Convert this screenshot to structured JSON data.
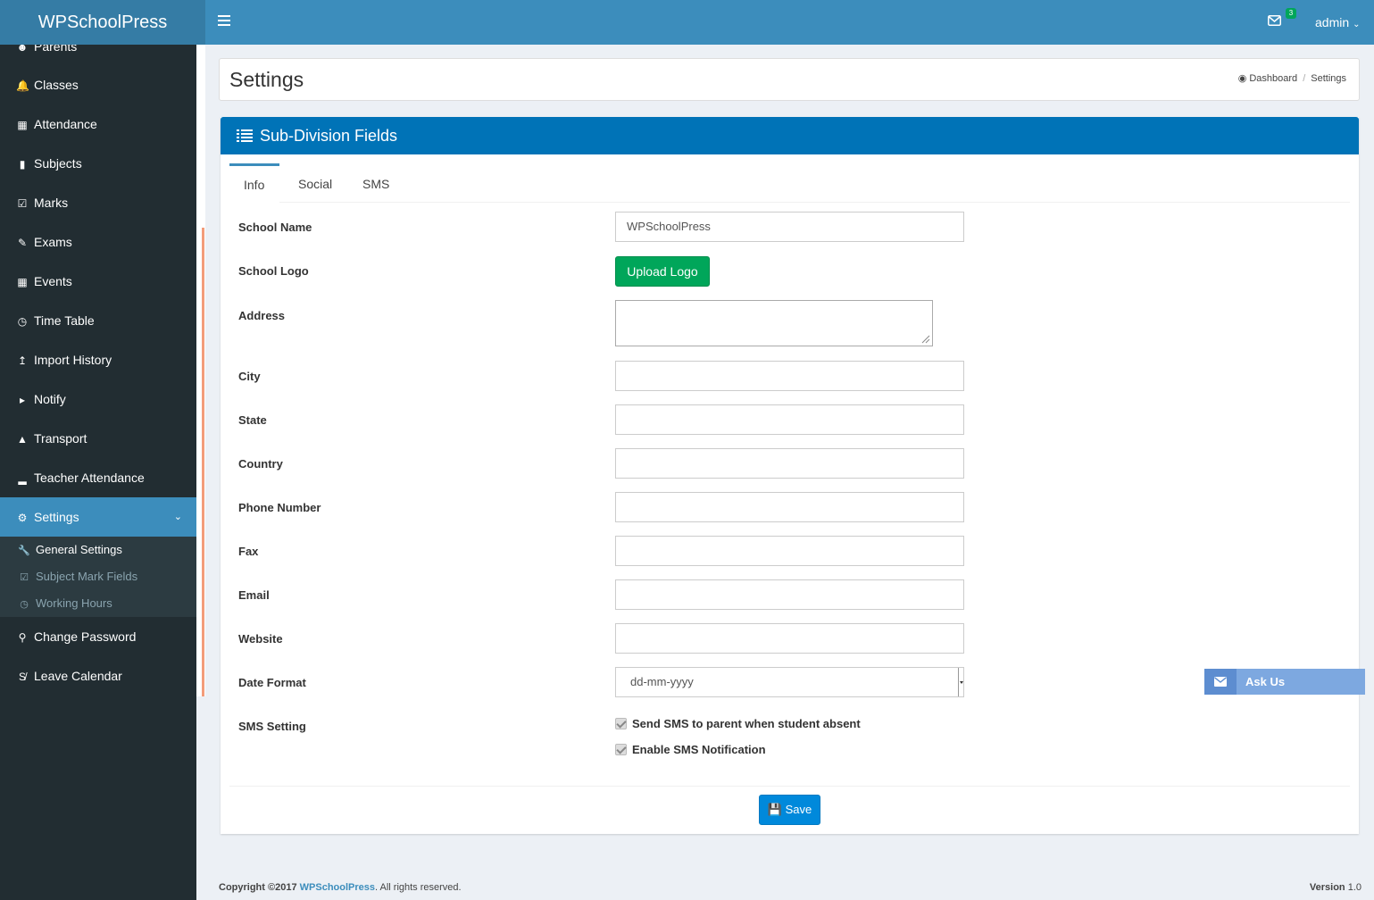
{
  "app": {
    "logo": "WPSchoolPress"
  },
  "topbar": {
    "mail_count": "3",
    "user": "admin"
  },
  "sidebar": {
    "items": [
      {
        "label": "Parents",
        "icon": "users-icon"
      },
      {
        "label": "Classes",
        "icon": "bell-icon"
      },
      {
        "label": "Attendance",
        "icon": "table-icon"
      },
      {
        "label": "Subjects",
        "icon": "book-icon"
      },
      {
        "label": "Marks",
        "icon": "check-square-icon"
      },
      {
        "label": "Exams",
        "icon": "edit-icon"
      },
      {
        "label": "Events",
        "icon": "calendar-icon"
      },
      {
        "label": "Time Table",
        "icon": "clock-icon"
      },
      {
        "label": "Import History",
        "icon": "upload-icon"
      },
      {
        "label": "Notify",
        "icon": "bullhorn-icon"
      },
      {
        "label": "Transport",
        "icon": "road-icon"
      },
      {
        "label": "Teacher Attendance",
        "icon": "signal-icon"
      },
      {
        "label": "Settings",
        "icon": "gear-icon"
      },
      {
        "label": "Change Password",
        "icon": "key-icon"
      },
      {
        "label": "Leave Calendar",
        "icon": "strikethrough-icon"
      }
    ],
    "settings_submenu": [
      {
        "label": "General Settings",
        "icon": "wrench-icon"
      },
      {
        "label": "Subject Mark Fields",
        "icon": "check-square-icon"
      },
      {
        "label": "Working Hours",
        "icon": "clock-icon"
      }
    ]
  },
  "page": {
    "title": "Settings",
    "breadcrumb": {
      "home": "Dashboard",
      "current": "Settings"
    }
  },
  "panel": {
    "title": "Sub-Division Fields",
    "tabs": [
      "Info",
      "Social",
      "SMS"
    ]
  },
  "form": {
    "school_name": {
      "label": "School Name",
      "value": "WPSchoolPress"
    },
    "school_logo": {
      "label": "School Logo",
      "button": "Upload Logo"
    },
    "address": {
      "label": "Address",
      "value": ""
    },
    "city": {
      "label": "City",
      "value": ""
    },
    "state": {
      "label": "State",
      "value": ""
    },
    "country": {
      "label": "Country",
      "value": ""
    },
    "phone": {
      "label": "Phone Number",
      "value": ""
    },
    "fax": {
      "label": "Fax",
      "value": ""
    },
    "email": {
      "label": "Email",
      "value": ""
    },
    "website": {
      "label": "Website",
      "value": ""
    },
    "date_format": {
      "label": "Date Format",
      "value": "dd-mm-yyyy"
    },
    "sms_setting": {
      "label": "SMS Setting",
      "opt1": "Send SMS to parent when student absent",
      "opt2": "Enable SMS Notification"
    },
    "save": "Save"
  },
  "ask_us": "Ask Us",
  "footer": {
    "copyright": "Copyright ©2017 ",
    "brand": "WPSchoolPress",
    "rights": ". All rights reserved.",
    "version_label": "Version",
    "version": " 1.0"
  },
  "colors": {
    "topbar": "#3c8dbc",
    "logo_bg": "#357ca5",
    "sidebar": "#222d32",
    "panel_head": "#0073b7",
    "upload_btn": "#00a65a",
    "save_btn": "#0089db"
  }
}
